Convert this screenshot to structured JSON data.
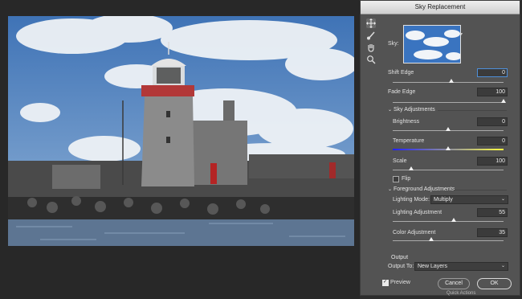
{
  "dialog": {
    "title": "Sky Replacement",
    "sky_label": "Sky:",
    "shift_edge": {
      "label": "Shift Edge",
      "value": "0",
      "fraction": 0.53
    },
    "fade_edge": {
      "label": "Fade Edge",
      "value": "100",
      "fraction": 1.0
    },
    "sky_adjustments": {
      "header": "Sky Adjustments",
      "brightness": {
        "label": "Brightness",
        "value": "0",
        "fraction": 0.5
      },
      "temperature": {
        "label": "Temperature",
        "value": "0",
        "fraction": 0.5
      },
      "scale": {
        "label": "Scale",
        "value": "100",
        "fraction": 0.17
      },
      "flip_label": "Flip"
    },
    "foreground_adjustments": {
      "header": "Foreground Adjustments",
      "lighting_mode_label": "Lighting Mode:",
      "lighting_mode_value": "Multiply",
      "lighting_adjustment": {
        "label": "Lighting Adjustment",
        "value": "55",
        "fraction": 0.55
      },
      "color_adjustment": {
        "label": "Color Adjustment",
        "value": "35",
        "fraction": 0.35
      }
    },
    "output": {
      "header": "Output",
      "output_to_label": "Output To:",
      "output_to_value": "New Layers"
    },
    "preview_label": "Preview",
    "preview_checked": true,
    "cancel_label": "Cancel",
    "ok_label": "OK"
  },
  "tools": [
    "move-sky-tool-icon",
    "sky-brush-icon",
    "hand-icon",
    "zoom-icon"
  ],
  "background_panel_text": "Quick Actions",
  "colors": {
    "focus_ring": "#4e8fd9",
    "dialog_bg": "#535353",
    "workspace_bg": "#282828"
  }
}
